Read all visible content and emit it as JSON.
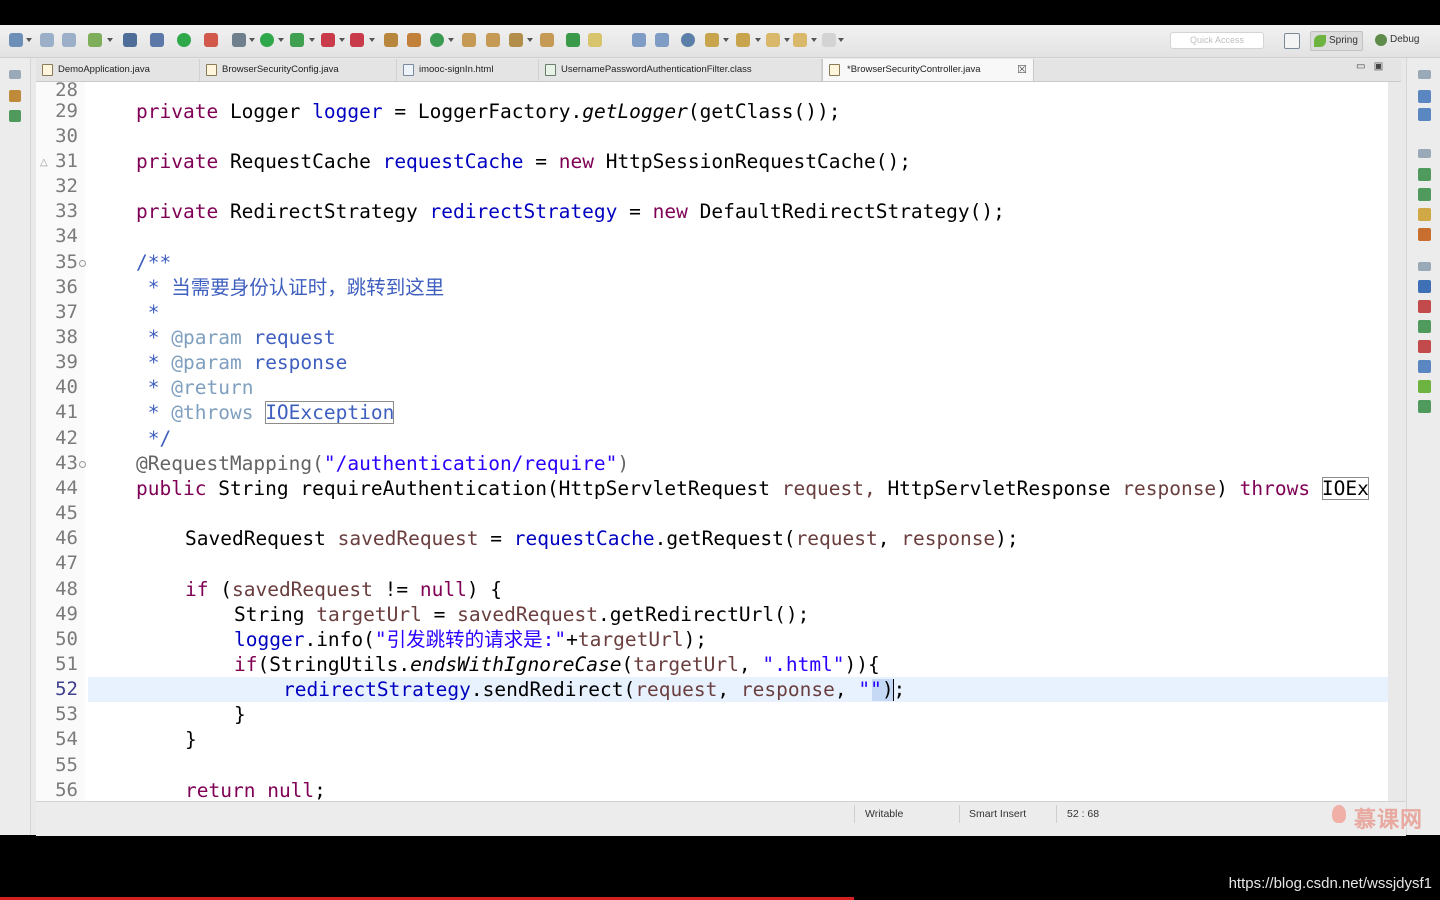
{
  "toolbar": {
    "quick_access_placeholder": "Quick Access",
    "perspectives": [
      "Spring",
      "Debug"
    ]
  },
  "tabs": [
    {
      "label": "DemoApplication.java",
      "active": false
    },
    {
      "label": "BrowserSecurityConfig.java",
      "active": false
    },
    {
      "label": "imooc-signIn.html",
      "active": false
    },
    {
      "label": "UsernamePasswordAuthenticationFilter.class",
      "active": false
    },
    {
      "label": "*BrowserSecurityController.java",
      "active": true
    }
  ],
  "tab_close_glyph": "☒",
  "editor": {
    "line_numbers": [
      "28",
      "29",
      "30",
      "31",
      "32",
      "33",
      "34",
      "35",
      "36",
      "37",
      "38",
      "39",
      "40",
      "41",
      "42",
      "43",
      "44",
      "45",
      "46",
      "47",
      "48",
      "49",
      "50",
      "51",
      "52",
      "53",
      "54",
      "55",
      "56"
    ],
    "current_line": "52",
    "code": {
      "l29": {
        "kw": "private",
        "type": "Logger",
        "name": "logger",
        "eq": "=",
        "cls": "LoggerFactory.",
        "method": "getLogger",
        "rest": "(getClass());"
      },
      "l31": {
        "kw": "private",
        "type": "RequestCache",
        "name": "requestCache",
        "eq": "=",
        "new": "new",
        "rest": "HttpSessionRequestCache();"
      },
      "l33": {
        "kw": "private",
        "type": "RedirectStrategy",
        "name": "redirectStrategy",
        "eq": "=",
        "new": "new",
        "rest": "DefaultRedirectStrategy();"
      },
      "l35": "/**",
      "l36": {
        "star": "*",
        "text": "当需要身份认证时，跳转到这里"
      },
      "l37": "*",
      "l38": {
        "star": "*",
        "tag": "@param",
        "name": "request"
      },
      "l39": {
        "star": "*",
        "tag": "@param",
        "name": "response"
      },
      "l40": {
        "star": "*",
        "tag": "@return"
      },
      "l41": {
        "star": "*",
        "tag": "@throws",
        "name": "IOException"
      },
      "l42": "*/",
      "l43": {
        "anno": "@RequestMapping(",
        "str": "\"/authentication/require\"",
        "close": ")"
      },
      "l44": {
        "kw1": "public",
        "type": "String",
        "sig": "requireAuthentication(HttpServletRequest",
        "p1": "request,",
        "t2": "HttpServletResponse",
        "p2": "response",
        "close": ")",
        "throws": "throws",
        "ex": "IOEx"
      },
      "l46": {
        "type": "SavedRequest",
        "var": "savedRequest",
        "eq": "=",
        "fld": "requestCache",
        "call": ".getRequest(",
        "a1": "request",
        "comma": ",",
        "a2": "response",
        "end": ");"
      },
      "l48": {
        "kw": "if",
        "open": "(",
        "var": "savedRequest",
        "op": "!=",
        "null": "null",
        "end": ") {"
      },
      "l49": {
        "type": "String",
        "var": "targetUrl",
        "eq": "=",
        "obj": "savedRequest",
        "call": ".getRedirectUrl();"
      },
      "l50": {
        "fld": "logger",
        "call": ".info(",
        "str": "\"引发跳转的请求是:\"",
        "plus": "+",
        "var": "targetUrl",
        "end": ");"
      },
      "l51": {
        "kw": "if",
        "a": "(StringUtils.",
        "method": "endsWithIgnoreCase",
        "b": "(",
        "var": "targetUrl",
        "comma": ",",
        "str": "\".html\"",
        "end": ")){"
      },
      "l52": {
        "fld": "redirectStrategy",
        "call": ".sendRedirect(",
        "a1": "request",
        "c1": ",",
        "a2": "response",
        "c2": ",",
        "str": "\"\"",
        "end": ");"
      },
      "l53": "}",
      "l54": "}",
      "l56": {
        "kw": "return",
        "null": "null",
        "end": ";"
      }
    }
  },
  "status": {
    "writable": "Writable",
    "insert_mode": "Smart Insert",
    "position": "52 : 68"
  },
  "watermark": "慕课网",
  "source_url": "https://blog.csdn.net/wssjdysf1",
  "video_progress": 0.593
}
